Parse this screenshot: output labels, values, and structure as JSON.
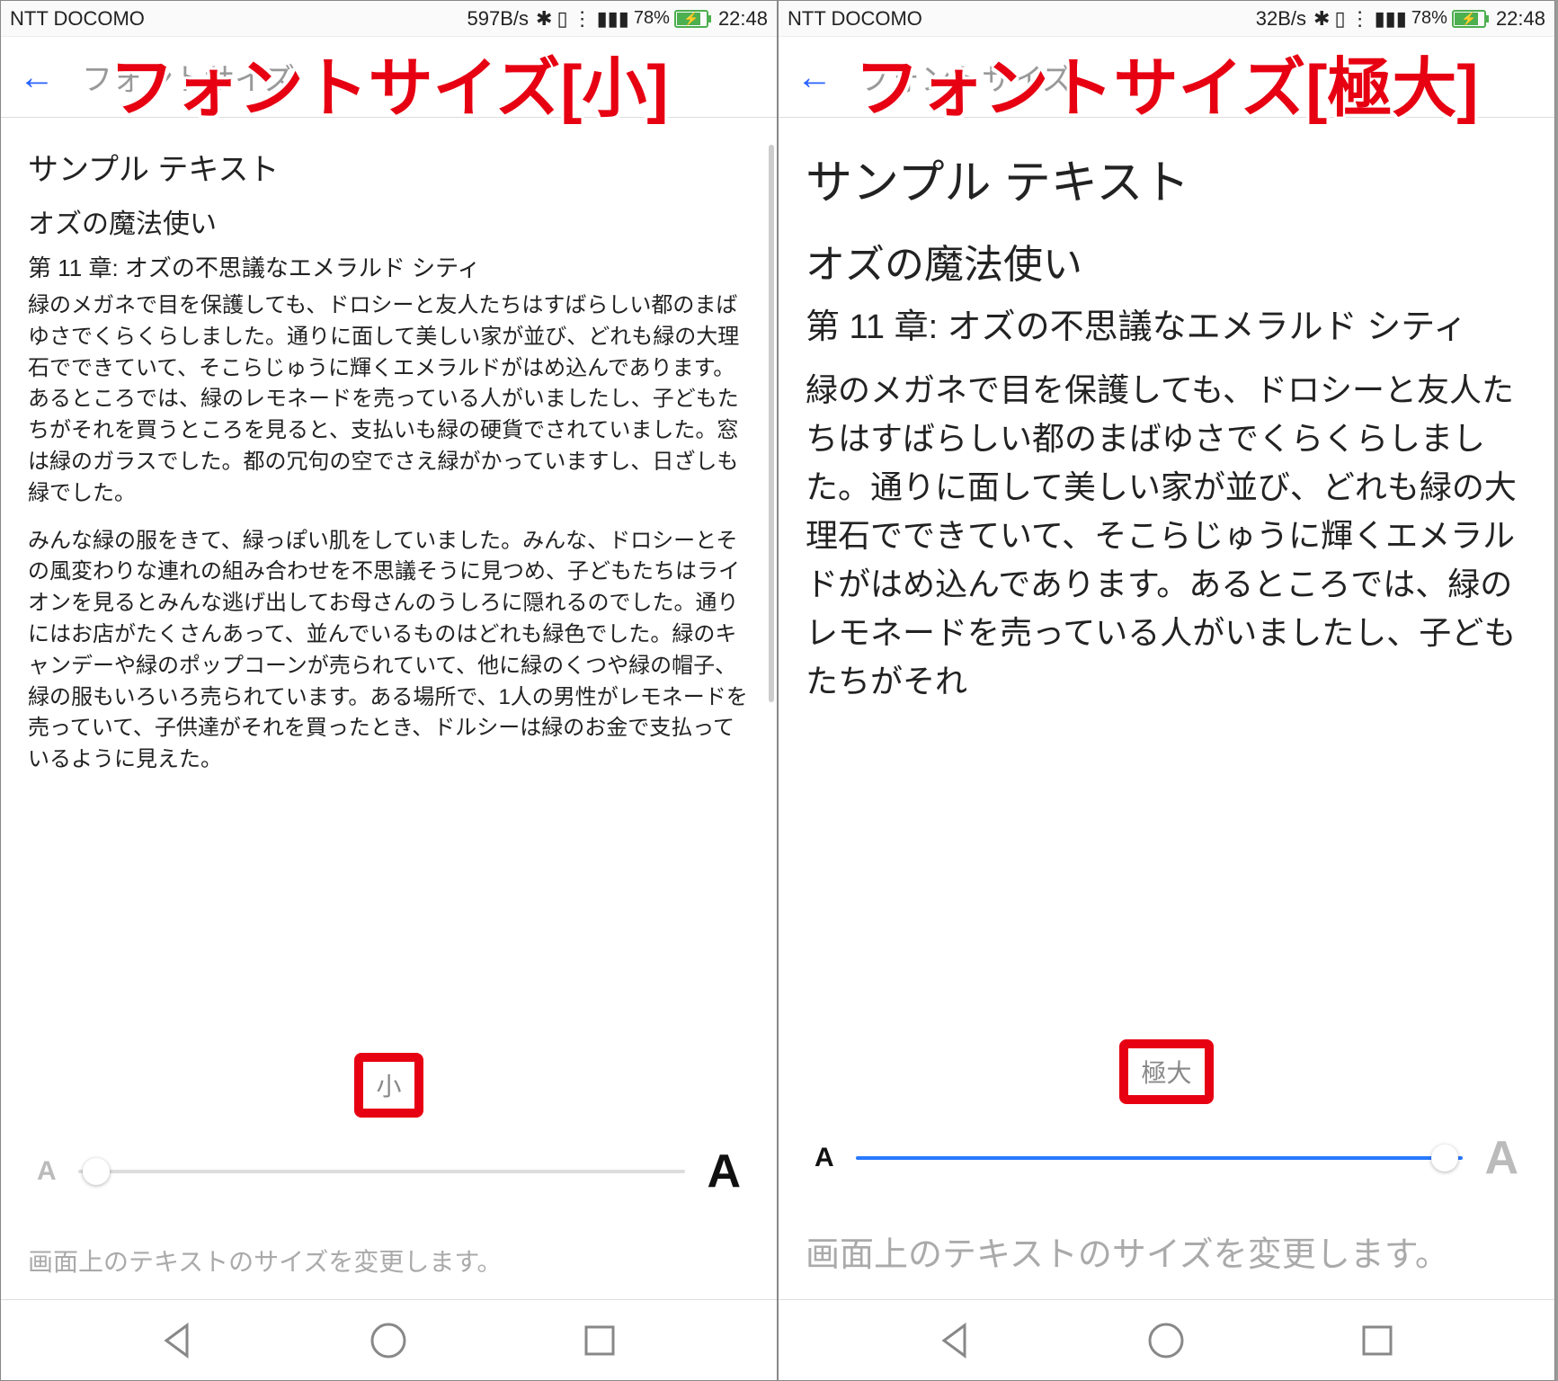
{
  "left": {
    "overlay_title": "フォントサイズ[小]",
    "statusbar": {
      "carrier": "NTT DOCOMO",
      "speed": "597B/s",
      "battery_percent": "78%",
      "time": "22:48"
    },
    "appbar": {
      "title": "フォントサイズ"
    },
    "sample": {
      "heading": "サンプル テキスト",
      "subtitle": "オズの魔法使い",
      "chapter": "第 11 章: オズの不思議なエメラルド シティ",
      "p1": "緑のメガネで目を保護しても、ドロシーと友人たちはすばらしい都のまばゆさでくらくらしました。通りに面して美しい家が並び、どれも緑の大理石でできていて、そこらじゅうに輝くエメラルドがはめ込んであります。あるところでは、緑のレモネードを売っている人がいましたし、子どもたちがそれを買うところを見ると、支払いも緑の硬貨でされていました。窓は緑のガラスでした。都の冗句の空でさえ緑がかっていますし、日ざしも緑でした。",
      "p2": "みんな緑の服をきて、緑っぽい肌をしていました。みんな、ドロシーとその風変わりな連れの組み合わせを不思議そうに見つめ、子どもたちはライオンを見るとみんな逃げ出してお母さんのうしろに隠れるのでした。通りにはお店がたくさんあって、並んでいるものはどれも緑色でした。緑のキャンデーや緑のポップコーンが売られていて、他に緑のくつや緑の帽子、緑の服もいろいろ売られています。ある場所で、1人の男性がレモネードを売っていて、子供達がそれを買ったとき、ドルシーは緑のお金で支払っているように見えた。"
    },
    "size_label": "小",
    "hint": "画面上のテキストのサイズを変更します。"
  },
  "right": {
    "overlay_title": "フォントサイズ[極大]",
    "statusbar": {
      "carrier": "NTT DOCOMO",
      "speed": "32B/s",
      "battery_percent": "78%",
      "time": "22:48"
    },
    "appbar": {
      "title": "フォントサイズ"
    },
    "sample": {
      "heading": "サンプル テキスト",
      "subtitle": "オズの魔法使い",
      "chapter": "第 11 章: オズの不思議なエメラルド シティ",
      "p1": "緑のメガネで目を保護しても、ドロシーと友人たちはすばらしい都のまばゆさでくらくらしました。通りに面して美しい家が並び、どれも緑の大理石でできていて、そこらじゅうに輝くエメラルドがはめ込んであります。あるところでは、緑のレモネードを売っている人がいましたし、子どもたちがそれ"
    },
    "size_label": "極大",
    "hint": "画面上のテキストのサイズを変更します。"
  }
}
